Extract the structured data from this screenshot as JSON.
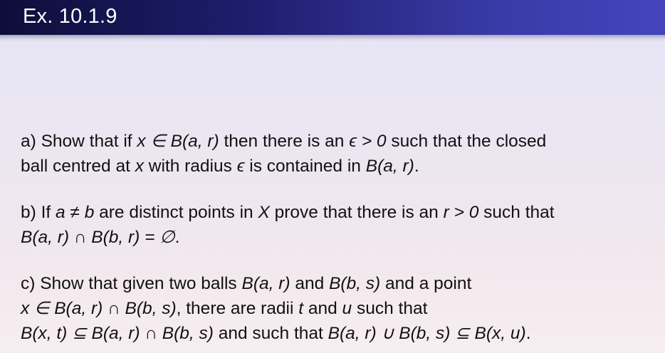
{
  "title": "Ex. 10.1.9",
  "parts": [
    {
      "id": "a",
      "lines": [
        [
          "a) Show that if ",
          {
            "math": "x ∈ B(a, r)"
          },
          " then there is an ",
          {
            "math": "ϵ > 0"
          },
          " such that the closed"
        ],
        [
          "ball centred at ",
          {
            "math": "x"
          },
          " with radius ",
          {
            "math": "ϵ"
          },
          " is contained in ",
          {
            "math": "B(a, r)"
          },
          "."
        ]
      ]
    },
    {
      "id": "b",
      "lines": [
        [
          "b) If ",
          {
            "math": "a ≠ b"
          },
          " are distinct points in ",
          {
            "math": "X"
          },
          " prove that there is an ",
          {
            "math": "r > 0"
          },
          " such that"
        ],
        [
          {
            "math": "B(a, r) ∩ B(b, r) = ∅"
          },
          "."
        ]
      ]
    },
    {
      "id": "c",
      "lines": [
        [
          "c) Show that given two balls ",
          {
            "math": "B(a, r)"
          },
          " and ",
          {
            "math": "B(b, s)"
          },
          " and a point"
        ],
        [
          {
            "math": "x ∈ B(a, r) ∩ B(b, s)"
          },
          ", there are radii ",
          {
            "math": "t"
          },
          " and ",
          {
            "math": "u"
          },
          " such that"
        ],
        [
          {
            "math": "B(x, t) ⊆ B(a, r) ∩ B(b, s)"
          },
          " and such that ",
          {
            "math": "B(a, r) ∪ B(b, s) ⊆ B(x, u)"
          },
          "."
        ]
      ]
    }
  ]
}
